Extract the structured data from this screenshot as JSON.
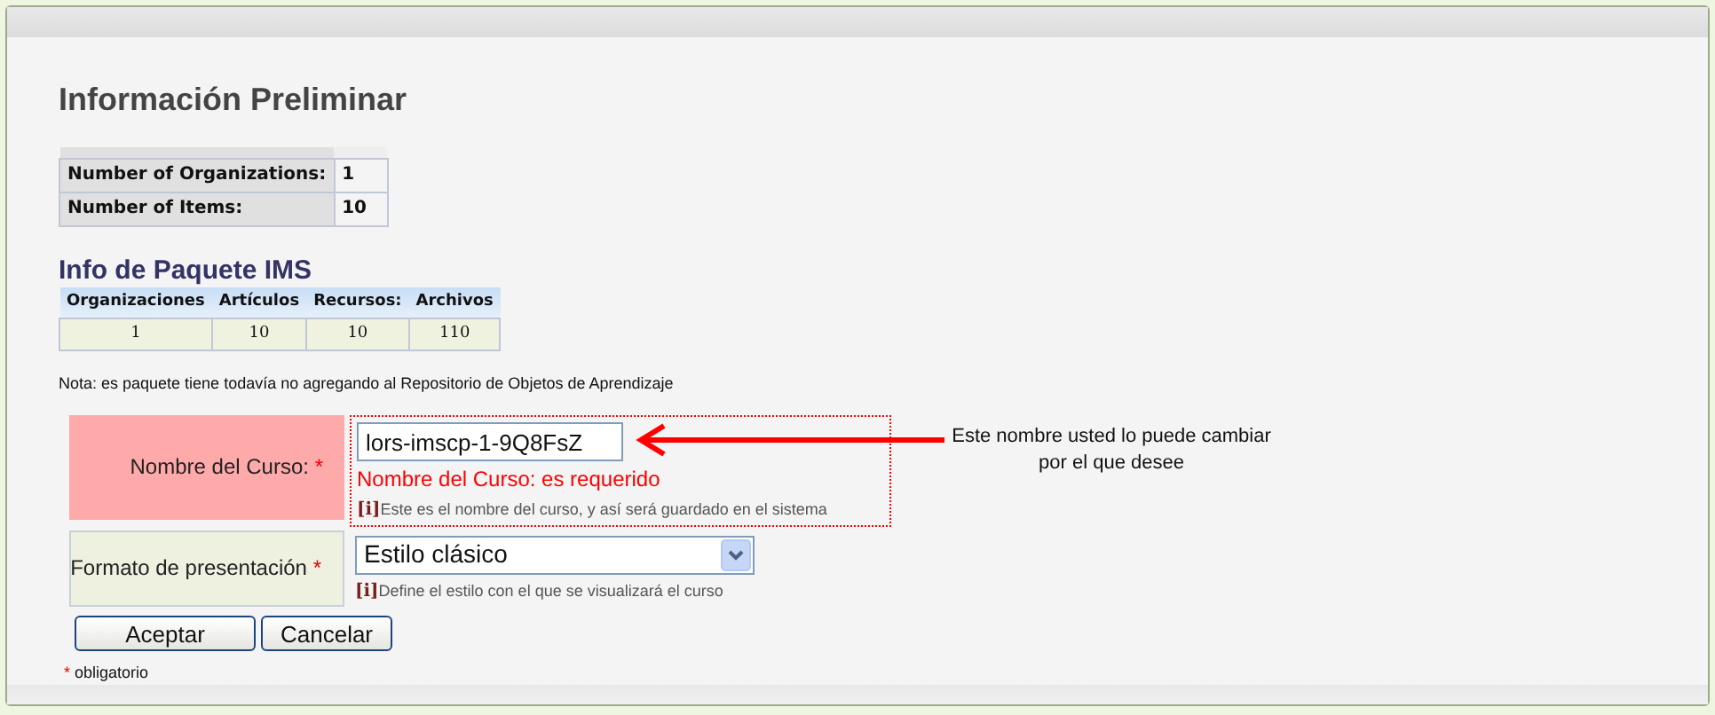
{
  "title": "Información Preliminar",
  "summary_table": [
    {
      "label": "Number of Organizations:",
      "value": "1"
    },
    {
      "label": "Number of Items:",
      "value": "10"
    }
  ],
  "ims_section": {
    "title": "Info de Paquete IMS",
    "columns": [
      "Organizaciones",
      "Artículos",
      "Recursos:",
      "Archivos"
    ],
    "rows": [
      [
        "1",
        "10",
        "10",
        "110"
      ]
    ]
  },
  "note": "Nota: es paquete tiene todavía no agregando al Repositorio de Objetos de Aprendizaje",
  "form": {
    "required_mark": "*",
    "fields": [
      {
        "kind": "text",
        "label": "Nombre del Curso:",
        "required": true,
        "value": "lors-imscp-1-9Q8FsZ",
        "error": "Nombre del Curso: es requerido",
        "info_mark": "[i]",
        "help": "Este es el nombre del curso, y así será guardado en el sistema"
      },
      {
        "kind": "select",
        "label": "Formato de presentación",
        "required": true,
        "value": "Estilo clásico",
        "info_mark": "[i]",
        "help": "Define el estilo con el que se visualizará el curso"
      }
    ]
  },
  "buttons": [
    "Aceptar",
    "Cancelar"
  ],
  "required_legend": {
    "mark": "*",
    "text": "obligatorio"
  },
  "annotation": "Este nombre usted lo puede cambiar por el que desee"
}
